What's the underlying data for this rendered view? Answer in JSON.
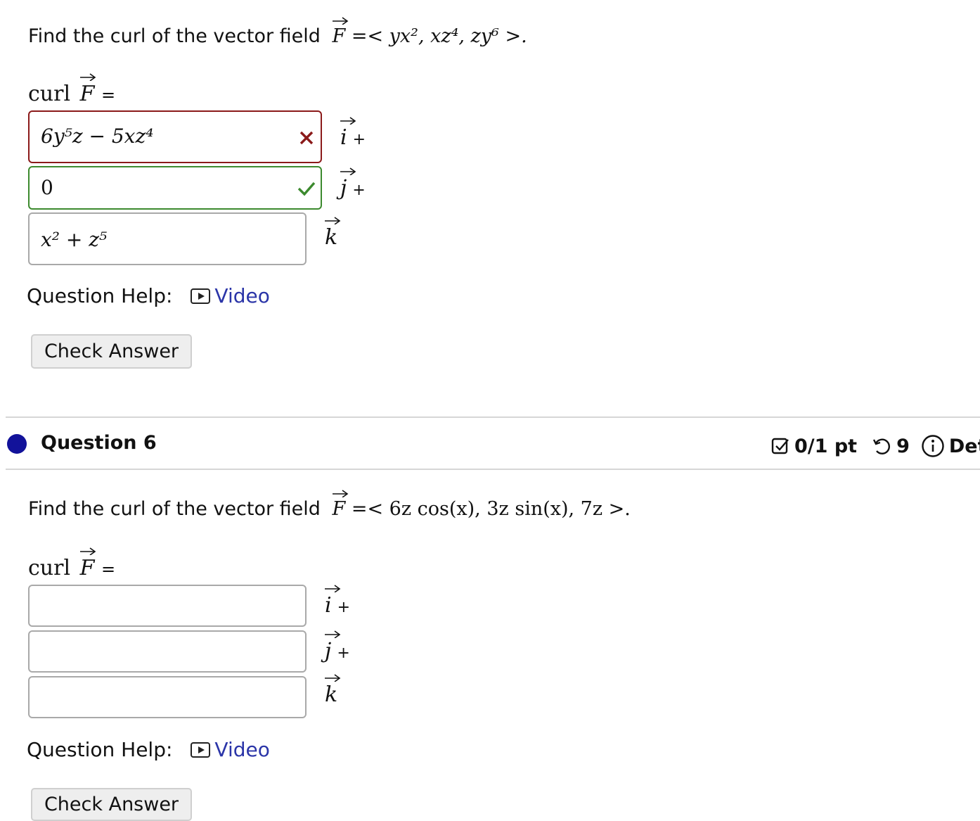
{
  "q5": {
    "prompt_text": "Find the curl of the vector field",
    "field_expr": "=< yx², xz⁴, zy⁶ >.",
    "curl_label": "curl",
    "curl_F": "F",
    "curl_eq": "=",
    "answers": [
      {
        "value": "6y⁵z − 5xz⁴",
        "unit": "i",
        "suffix": "+",
        "status": "incorrect"
      },
      {
        "value": "0",
        "unit": "j",
        "suffix": "+",
        "status": "correct"
      },
      {
        "value": "x² + z⁵",
        "unit": "k",
        "suffix": "",
        "status": "none"
      }
    ],
    "help_label": "Question Help:",
    "help_link": "Video",
    "check_button": "Check Answer"
  },
  "q6": {
    "title": "Question 6",
    "points": "0/1 pt",
    "retries": "9",
    "details": "Det",
    "prompt_text": "Find the curl of the vector field",
    "field_expr": "=< 6z cos(x), 3z sin(x), 7z >.",
    "curl_label": "curl",
    "curl_F": "F",
    "curl_eq": "=",
    "answers": [
      {
        "value": "",
        "unit": "i",
        "suffix": "+"
      },
      {
        "value": "",
        "unit": "j",
        "suffix": "+"
      },
      {
        "value": "",
        "unit": "k",
        "suffix": ""
      }
    ],
    "help_label": "Question Help:",
    "help_link": "Video",
    "check_button": "Check Answer"
  },
  "colors": {
    "incorrect": "#8b1a1a",
    "correct": "#3c8a2e",
    "link": "#2b35a8",
    "question_dot": "#12129a"
  }
}
